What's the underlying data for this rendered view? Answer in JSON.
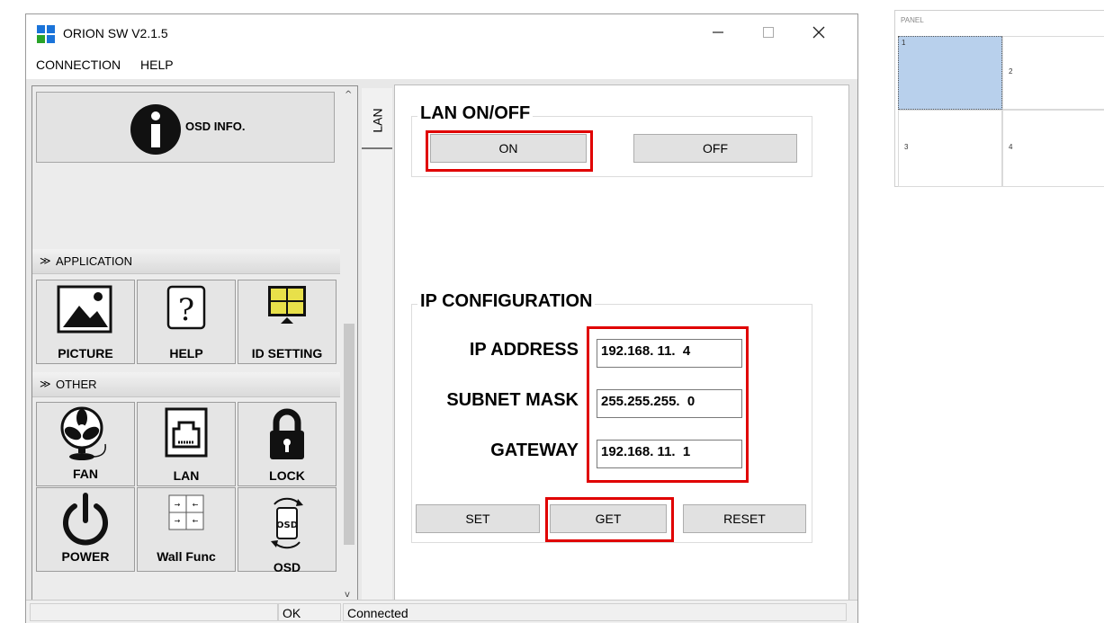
{
  "window": {
    "title": "ORION SW V2.1.5",
    "menu": [
      "CONNECTION",
      "HELP"
    ]
  },
  "left_panel": {
    "osd_info_label": "OSD INFO.",
    "sections": [
      {
        "title": "APPLICATION",
        "items": [
          "PICTURE",
          "HELP",
          "ID SETTING"
        ]
      },
      {
        "title": "OTHER",
        "items": [
          "FAN",
          "LAN",
          "LOCK",
          "POWER",
          "Wall Func",
          "OSD"
        ]
      }
    ]
  },
  "tabs": [
    "LAN"
  ],
  "lan_panel": {
    "lan_group_title": "LAN ON/OFF",
    "on_label": "ON",
    "off_label": "OFF",
    "ip_group_title": "IP CONFIGURATION",
    "fields": [
      {
        "label": "IP ADDRESS",
        "value": "192.168. 11.  4"
      },
      {
        "label": "SUBNET MASK",
        "value": "255.255.255.  0"
      },
      {
        "label": "GATEWAY",
        "value": "192.168. 11.  1"
      }
    ],
    "buttons": [
      "SET",
      "GET",
      "RESET"
    ]
  },
  "status_bar": {
    "status": "OK",
    "connection": "Connected"
  },
  "panel_preview": {
    "title": "PANEL",
    "cells": [
      "1",
      "2",
      "3",
      "4"
    ],
    "selected_cell": "1"
  },
  "colors": {
    "highlight": "#e00000",
    "selected_cell": "#b8d0ec"
  }
}
